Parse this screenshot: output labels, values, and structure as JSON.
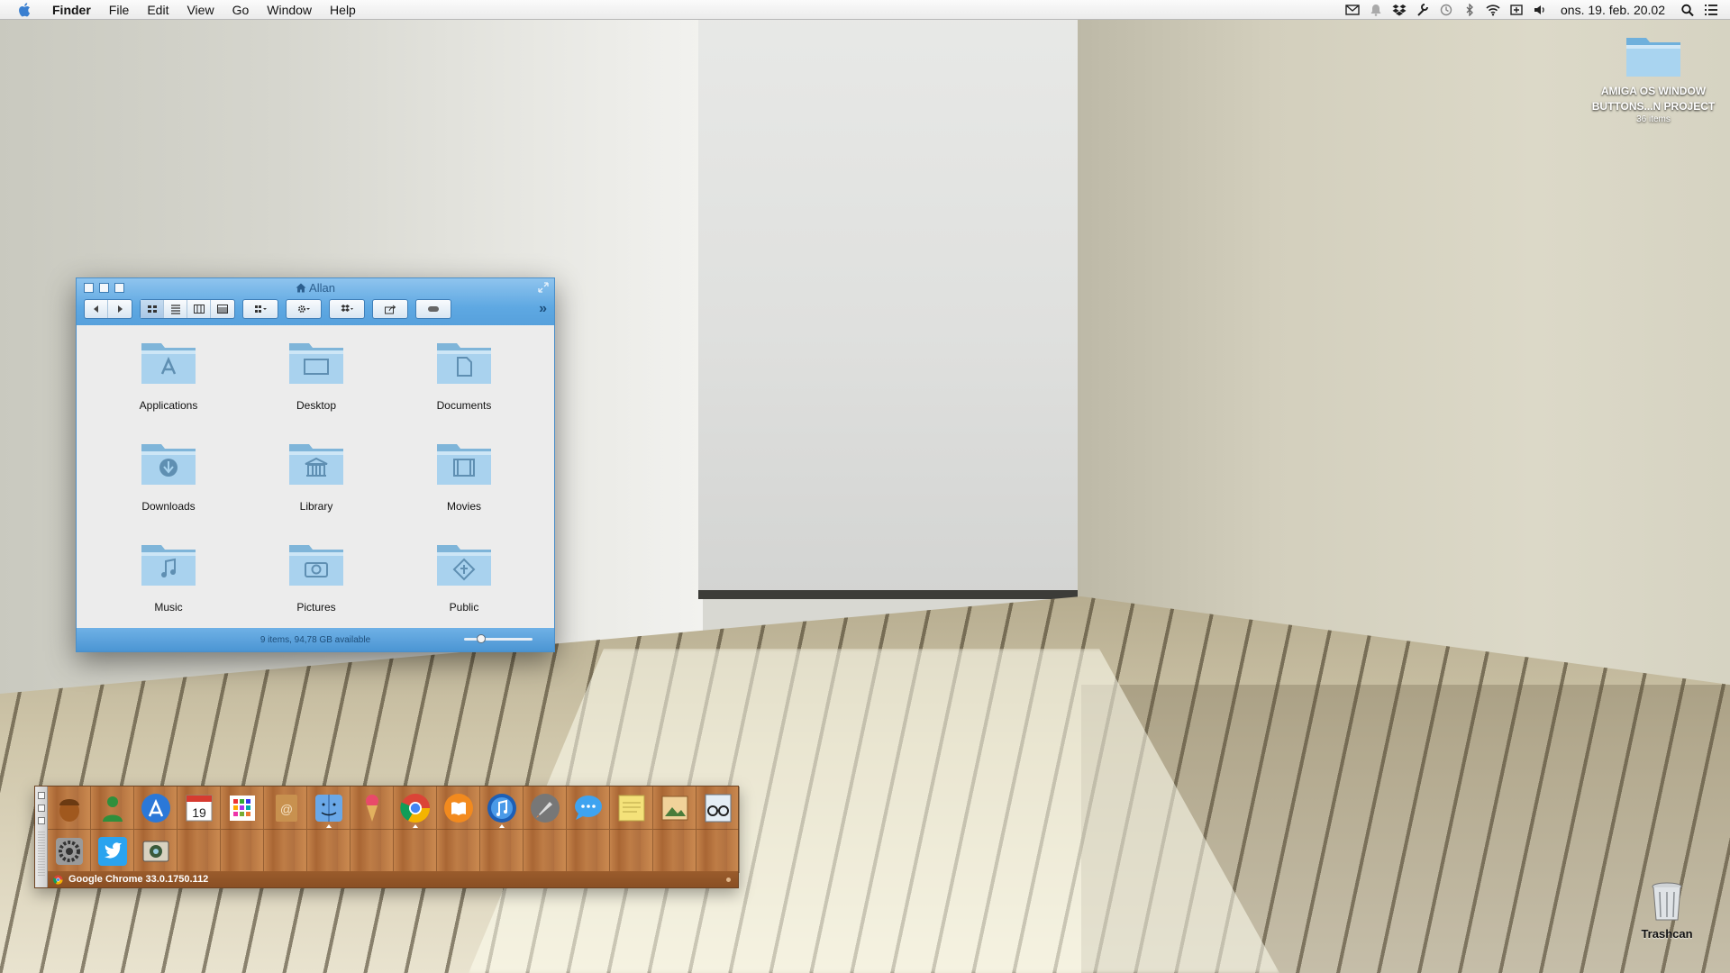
{
  "menubar": {
    "app_name": "Finder",
    "menus": [
      "File",
      "Edit",
      "View",
      "Go",
      "Window",
      "Help"
    ],
    "status_icons": [
      "mail-icon",
      "notification-icon",
      "dropbox-icon",
      "tool-icon",
      "time-machine-icon",
      "bluetooth-icon",
      "wifi-icon",
      "battery-icon",
      "volume-icon"
    ],
    "clock": "ons. 19. feb. 20.02"
  },
  "finder": {
    "title": "Allan",
    "status": "9 items, 94,78 GB available",
    "items": [
      {
        "label": "Applications",
        "icon": "applications-folder-icon"
      },
      {
        "label": "Desktop",
        "icon": "desktop-folder-icon"
      },
      {
        "label": "Documents",
        "icon": "documents-folder-icon"
      },
      {
        "label": "Downloads",
        "icon": "downloads-folder-icon"
      },
      {
        "label": "Library",
        "icon": "library-folder-icon"
      },
      {
        "label": "Movies",
        "icon": "movies-folder-icon"
      },
      {
        "label": "Music",
        "icon": "music-folder-icon"
      },
      {
        "label": "Pictures",
        "icon": "pictures-folder-icon"
      },
      {
        "label": "Public",
        "icon": "public-folder-icon"
      }
    ],
    "toolbar_icons": [
      "back-icon",
      "forward-icon",
      "icon-view-icon",
      "list-view-icon",
      "column-view-icon",
      "coverflow-view-icon",
      "arrange-icon",
      "action-gear-icon",
      "dropbox-icon",
      "share-icon",
      "tags-icon"
    ]
  },
  "desktop": {
    "folder_name": "AMIGA OS WINDOW BUTTONS...N PROJECT",
    "folder_sub": "36 items",
    "trash_label": "Trashcan"
  },
  "dock": {
    "status_text": "Google Chrome 33.0.1750.112",
    "apps": [
      "acorn-icon",
      "contacts-person-icon",
      "app-store-icon",
      "calendar-icon",
      "launchpad-grid-icon",
      "address-book-icon",
      "finder-icon",
      "ice-cream-icon",
      "chrome-icon",
      "ibooks-icon",
      "itunes-icon",
      "rocket-icon",
      "messages-icon",
      "stickies-icon",
      "iphoto-icon",
      "preview-glasses-icon",
      "system-preferences-icon",
      "twitter-icon",
      "image-capture-icon"
    ],
    "calendar_day": "19"
  }
}
